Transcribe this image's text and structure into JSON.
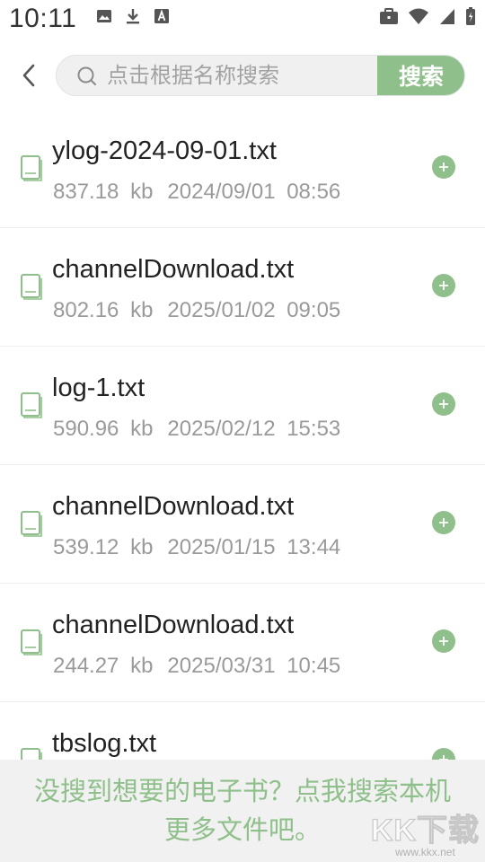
{
  "status_bar": {
    "time": "10:11",
    "left_icons": [
      "image-icon",
      "download-icon",
      "font-icon"
    ],
    "right_icons": [
      "briefcase-icon",
      "wifi-icon",
      "signal-icon",
      "battery-icon"
    ]
  },
  "search": {
    "back_icon": "chevron-left-icon",
    "placeholder": "点击根据名称搜索",
    "button_label": "搜索"
  },
  "files": [
    {
      "name": "ylog-2024-09-01.txt",
      "size": "837.18 kb",
      "date": "2024/09/01 08:56"
    },
    {
      "name": "channelDownload.txt",
      "size": "802.16 kb",
      "date": "2025/01/02 09:05"
    },
    {
      "name": "log-1.txt",
      "size": "590.96 kb",
      "date": "2025/02/12 15:53"
    },
    {
      "name": "channelDownload.txt",
      "size": "539.12 kb",
      "date": "2025/01/15 13:44"
    },
    {
      "name": "channelDownload.txt",
      "size": "244.27 kb",
      "date": "2025/03/31 10:45"
    },
    {
      "name": "tbslog.txt",
      "size": "",
      "date": ""
    }
  ],
  "banner": {
    "line1": "没搜到想要的电子书？点我搜索本机",
    "line2": "更多文件吧。"
  },
  "watermark": {
    "logo": "KK下载",
    "url": "www.kkx.net"
  },
  "colors": {
    "accent": "#8fbf8a",
    "file_icon": "#8fbf8a",
    "meta_text": "#9a9a9a",
    "banner_bg": "#f1f1f1"
  }
}
